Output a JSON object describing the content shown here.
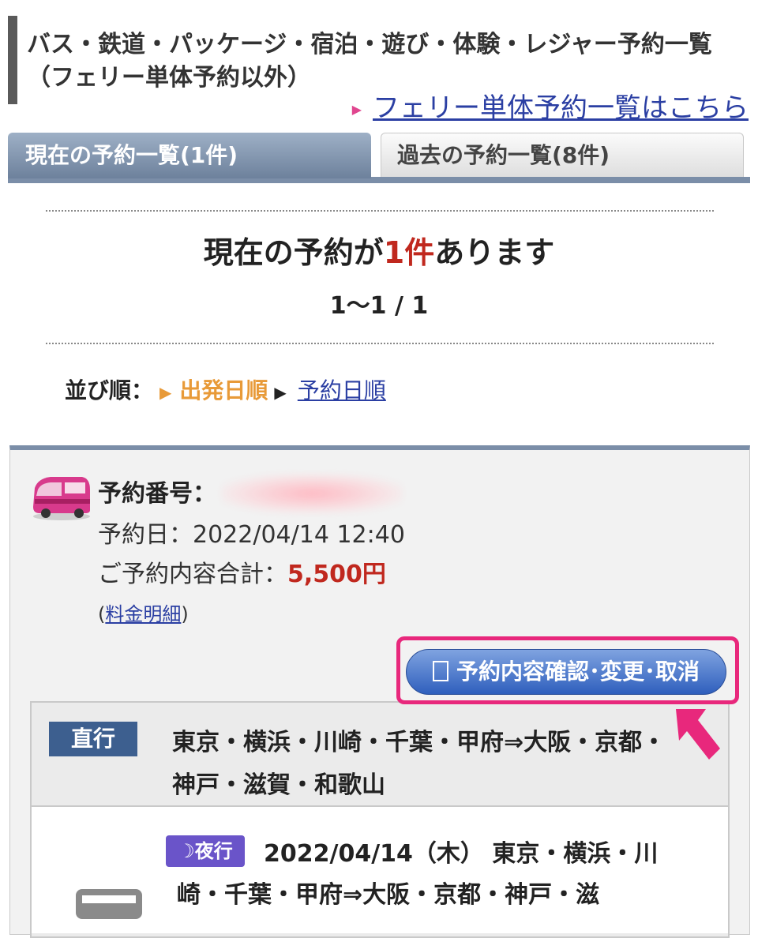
{
  "header": {
    "title": "バス・鉄道・パッケージ・宿泊・遊び・体験・レジャー予約一覧（フェリー単体予約以外）",
    "ferry_link": "フェリー単体予約一覧はこちら"
  },
  "tabs": [
    {
      "label": "現在の予約一覧(1件)",
      "active": true
    },
    {
      "label": "過去の予約一覧(8件)",
      "active": false
    }
  ],
  "summary": {
    "prefix": "現在の予約が",
    "count": "1件",
    "suffix": "あります",
    "paging": "1〜1 / 1"
  },
  "sort": {
    "label": "並び順：",
    "active": "出発日順",
    "other": "予約日順"
  },
  "reservation": {
    "number_label": "予約番号：",
    "date_label": "予約日：2022/04/14 12:40",
    "total_label": "ご予約内容合計：",
    "total_value": "5,500円",
    "fee_open": "(",
    "fee_link": "料金明細",
    "fee_close": ")",
    "action_button": "予約内容確認･変更･取消",
    "route_badge": "直行",
    "route": "東京・横浜・川崎・千葉・甲府⇒大阪・京都・神戸・滋賀・和歌山",
    "trip_badge": "夜行",
    "trip": "2022/04/14（木） 東京・横浜・川崎・千葉・甲府⇒大阪・京都・神戸・滋"
  },
  "colors": {
    "accent_red": "#c0281e",
    "highlight_pink": "#e8287c",
    "sort_orange": "#e89a38",
    "tab_blue": "#7b8ea8"
  },
  "icons": [
    "bus-icon",
    "document-icon",
    "pointer-arrow-icon",
    "moon-icon"
  ]
}
